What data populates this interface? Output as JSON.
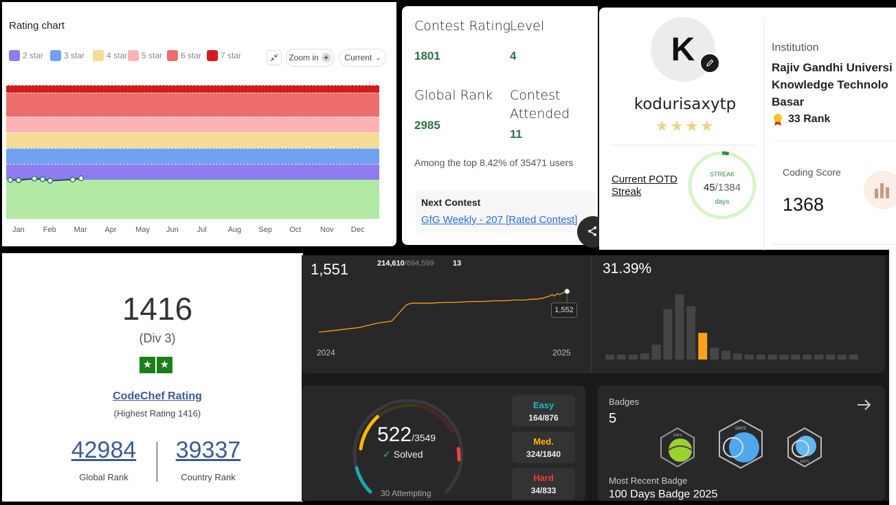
{
  "codechef_chart": {
    "title": "Rating chart",
    "legend": [
      {
        "label": "2 star",
        "color": "#8e7cf0"
      },
      {
        "label": "3 star",
        "color": "#6fa3f2"
      },
      {
        "label": "4 star",
        "color": "#f6dc94"
      },
      {
        "label": "5 star",
        "color": "#fdb3b3"
      },
      {
        "label": "6 star",
        "color": "#ee6e6e"
      },
      {
        "label": "7 star",
        "color": "#d31b1b"
      }
    ],
    "zoom_label": "Zoom in",
    "select_value": "Current",
    "months": [
      "Jan",
      "Feb",
      "Mar",
      "Apr",
      "May",
      "Jun",
      "Jul",
      "Aug",
      "Sep",
      "Oct",
      "Nov",
      "Dec"
    ]
  },
  "chart_data": [
    {
      "type": "line",
      "title": "Rating chart",
      "x": [
        "Jan",
        "Jan",
        "Feb",
        "Feb",
        "Feb",
        "Mar",
        "Mar"
      ],
      "series": [
        {
          "values": [
            1395,
            1392,
            1412,
            1403,
            1385,
            1400,
            1416
          ]
        }
      ],
      "ylim": [
        900,
        2600
      ],
      "bands": [
        {
          "from": 900,
          "to": 1400,
          "color": "#b2e9a4"
        },
        {
          "from": 1400,
          "to": 1600,
          "color": "#8e7cf0"
        },
        {
          "from": 1600,
          "to": 1800,
          "color": "#6fa3f2"
        },
        {
          "from": 1800,
          "to": 2000,
          "color": "#f6dc94"
        },
        {
          "from": 2000,
          "to": 2200,
          "color": "#fdb3b3"
        },
        {
          "from": 2200,
          "to": 2500,
          "color": "#ee6e6e"
        },
        {
          "from": 2500,
          "to": 2600,
          "color": "#d31b1b"
        }
      ]
    },
    {
      "type": "line",
      "x": [
        "2024",
        "2025"
      ],
      "series": [
        {
          "values": [
            1500,
            1503,
            1506,
            1512,
            1514,
            1535,
            1537,
            1537,
            1538,
            1538,
            1539,
            1539,
            1540,
            1540,
            1541,
            1541,
            1542,
            1542,
            1543,
            1543,
            1544,
            1545,
            1546,
            1548,
            1546,
            1549,
            1548,
            1551,
            1552,
            1551
          ]
        }
      ],
      "tooltip": "1,552"
    },
    {
      "type": "bar",
      "values": [
        1,
        1,
        1,
        2,
        5,
        17,
        22,
        18,
        9,
        4,
        3,
        2,
        1,
        1,
        1,
        1,
        1,
        1,
        1,
        1,
        1,
        1
      ],
      "highlight_index": 8
    }
  ],
  "gfg_contest": {
    "contest_rating_label": "Contest Rating",
    "contest_rating": "1801",
    "level_label": "Level",
    "level": "4",
    "global_rank_label": "Global Rank",
    "global_rank": "2985",
    "attended_label_1": "Contest",
    "attended_label_2": "Attended",
    "attended": "11",
    "top_text": "Among the top 8.42% of 35471 users",
    "next_contest_label": "Next Contest",
    "next_contest_link": "GfG Weekly - 207 [Rated Contest]"
  },
  "gfg_profile": {
    "avatar_letter": "K",
    "username": "kodurisaxytp",
    "stars": "★★★★",
    "potd_label_1": "Current POTD",
    "potd_label_2": "Streak",
    "streak_label": "STREAK",
    "streak_current": "45",
    "streak_total": "/1384",
    "streak_unit": "days",
    "streak_fraction": 0.033,
    "institution_label": "Institution",
    "institution_1": "Rajiv Gandhi Universi",
    "institution_2": "Knowledge Technolo",
    "institution_3": "Basar",
    "institution_rank": "33 Rank",
    "coding_score_label": "Coding Score",
    "coding_score": "1368"
  },
  "codechef_summary": {
    "rating": "1416",
    "division": "(Div 3)",
    "stars": "★★",
    "rating_link": "CodeChef Rating",
    "highest": "(Highest Rating 1416)",
    "global_rank": "42984",
    "global_rank_label": "Global Rank",
    "country_rank": "39337",
    "country_rank_label": "Country Rank"
  },
  "leetcode": {
    "rating": "1,551",
    "global_rank": "214,610",
    "global_total": "/694,599",
    "attended": "13",
    "year_start": "2024",
    "year_end": "2025",
    "tooltip": "1,552",
    "top_percent": "31.39%",
    "solved": "522",
    "total": "/3549",
    "solved_label": "Solved",
    "attempting": "30 Attempting",
    "easy_label": "Easy",
    "easy": "164/876",
    "medium_label": "Med.",
    "medium": "324/1840",
    "hard_label": "Hard",
    "hard": "34/833",
    "badges_label": "Badges",
    "badges_count": "5",
    "recent_badge_label": "Most Recent Badge",
    "recent_badge": "100 Days Badge 2025",
    "badge_days_text": "DAYS"
  }
}
